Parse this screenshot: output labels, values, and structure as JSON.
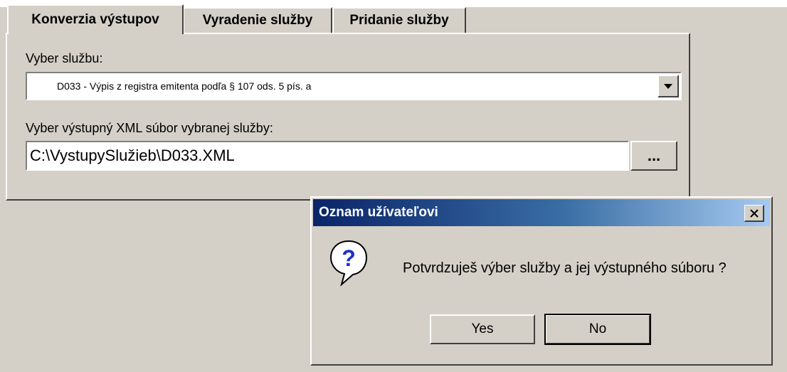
{
  "tabs": [
    {
      "label": "Konverzia výstupov",
      "active": true
    },
    {
      "label": "Vyradenie služby",
      "active": false
    },
    {
      "label": "Pridanie služby",
      "active": false
    }
  ],
  "form": {
    "service_label": "Vyber službu:",
    "service_selected": "D033 - Výpis z registra emitenta podľa § 107 ods. 5 pís. a",
    "file_label": "Vyber výstupný XML súbor vybranej služby:",
    "file_value": "C:\\VystupySlužieb\\D033.XML",
    "browse_label": "..."
  },
  "dialog": {
    "title": "Oznam užívateľovi",
    "message": "Potvrdzuješ výber služby a jej výstupného súboru ?",
    "yes_label": "Yes",
    "no_label": "No",
    "icon": "question-icon"
  },
  "colors": {
    "window_bg": "#d4d0c8",
    "title_start": "#0a246a",
    "title_end": "#a6caf0"
  }
}
